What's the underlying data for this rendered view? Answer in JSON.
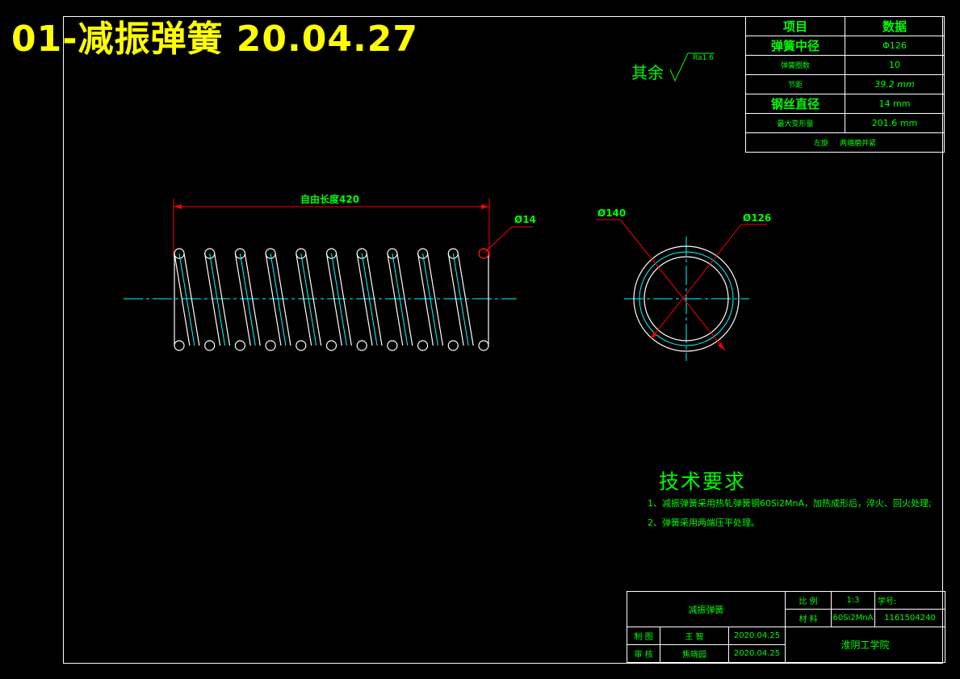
{
  "drawing": {
    "big_title": "01-减振弹簧 20.04.27",
    "roughness_label": "其余",
    "roughness_value": "Ra1.6"
  },
  "param_table": {
    "header": [
      "项目",
      "数据"
    ],
    "rows": [
      [
        "弹簧中径",
        "Φ126"
      ],
      [
        "弹簧圈数",
        "10"
      ],
      [
        "节距",
        "39.2 mm"
      ],
      [
        "钢丝直径",
        "14 mm"
      ],
      [
        "最大变形量",
        "201.6 mm"
      ]
    ],
    "note": "左旋     两端磨并紧"
  },
  "dimensions": {
    "free_length": "自由长度420",
    "wire_dia": "Ø14",
    "outer_dia": "Ø140",
    "mid_dia": "Ø126"
  },
  "tech_req": {
    "title": "技术要求",
    "items": [
      "1、减振弹簧采用热轧弹簧钢60Si2MnA，加热成形后，淬火、回火处理;",
      "2、弹簧采用两端压平处理。"
    ]
  },
  "title_block": {
    "part_name": "减振弹簧",
    "scale_label": "比 例",
    "scale_value": "1:3",
    "material_label": "材 料",
    "material_value": "60Si2MnA",
    "student_no_label": "学号:",
    "student_no": "1161504240",
    "drawn_label": "制 图",
    "drawn_name": "王 智",
    "drawn_date": "2020.04.25",
    "review_label": "审 核",
    "review_name": "焦晓园",
    "review_date": "2020.04.25",
    "school": "淮阴工学院"
  },
  "colors": {
    "lines": "#ffffff",
    "text": "#00ff00",
    "title": "#ffff00",
    "dimension": "#ff0000",
    "centerline": "#00ffff"
  }
}
